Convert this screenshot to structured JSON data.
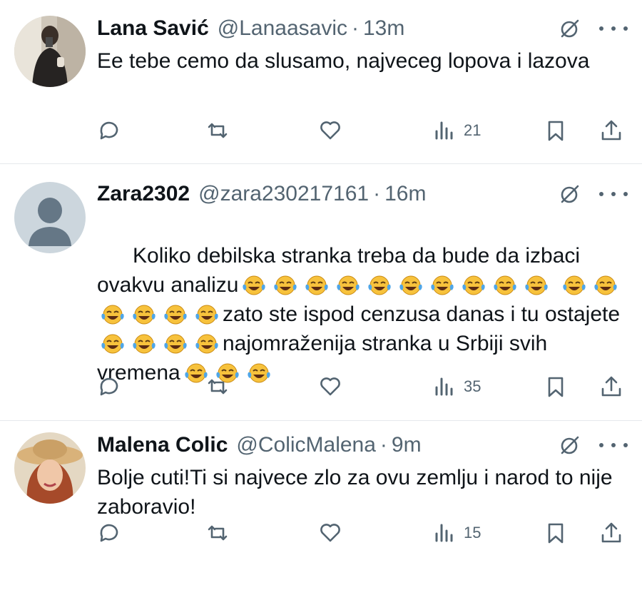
{
  "tweets": [
    {
      "name": "Lana Savić",
      "handle": "@Lanaasavic",
      "separator": "·",
      "time": "13m",
      "text": "Ee tebe cemo da slusamo, najveceg lopova i lazova",
      "views": "21",
      "avatar_icon": "profile-photo"
    },
    {
      "name": "Zara2302",
      "handle": "@zara230217161",
      "separator": "·",
      "time": "16m",
      "text_parts": [
        "Koliko debilska stranka treba da bude da izbaci ovakvu analizu",
        "zato ste ispod cenzusa danas i tu ostajete",
        "najomraženija stranka u Srbiji svih vremena"
      ],
      "emoji_runs": [
        10,
        6,
        4,
        3
      ],
      "emoji_icon": "face-with-tears-of-joy",
      "views": "35",
      "avatar_icon": "default-profile-avatar"
    },
    {
      "name": "Malena Colic",
      "handle": "@ColicMalena",
      "separator": "·",
      "time": "9m",
      "text": "Bolje cuti!Ti si najvece zlo za ovu zemlju i narod to nije zaboravio!",
      "views": "15",
      "avatar_icon": "profile-photo"
    }
  ],
  "colors": {
    "text": "#0f1419",
    "secondary": "#536471",
    "divider": "#e6e9ec",
    "default_avatar_bg": "#ccd6dd",
    "default_avatar_fg": "#657786"
  },
  "icons": {
    "header": [
      "grok-icon",
      "more-icon"
    ],
    "actions": [
      "reply-icon",
      "retweet-icon",
      "like-icon",
      "views-icon",
      "bookmark-icon",
      "share-icon"
    ]
  }
}
